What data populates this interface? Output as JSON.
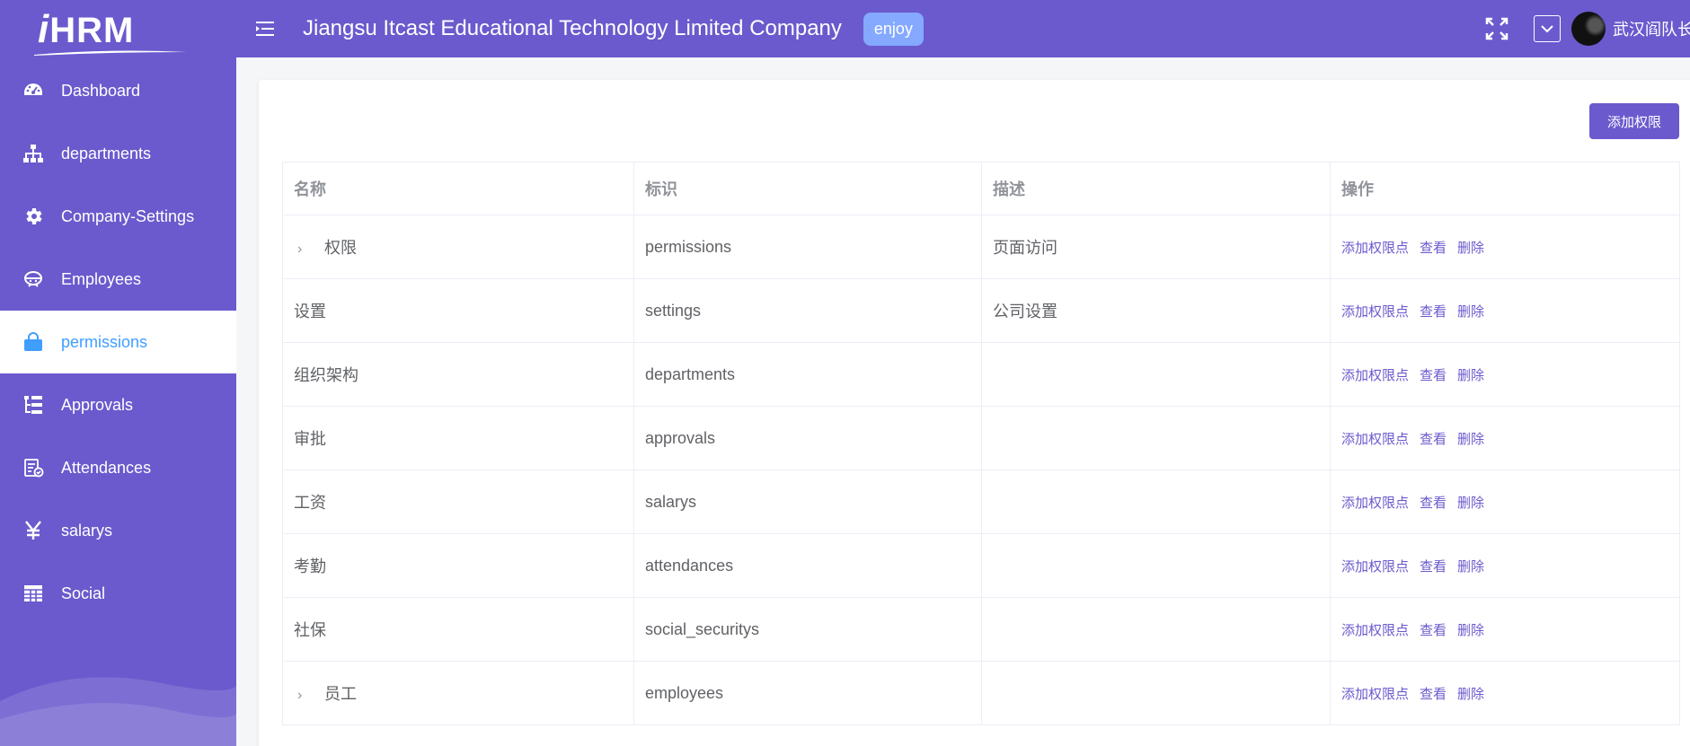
{
  "logo": {
    "text_i": "i",
    "text_rest": "HRM"
  },
  "sidebar": {
    "items": [
      {
        "label": "Dashboard",
        "icon": "dashboard-icon"
      },
      {
        "label": "departments",
        "icon": "org-tree-icon"
      },
      {
        "label": "Company-Settings",
        "icon": "gear-icon"
      },
      {
        "label": "Employees",
        "icon": "people-icon"
      },
      {
        "label": "permissions",
        "icon": "lock-icon",
        "active": true
      },
      {
        "label": "Approvals",
        "icon": "tree-table-icon"
      },
      {
        "label": "Attendances",
        "icon": "clipboard-icon"
      },
      {
        "label": "salarys",
        "icon": "yen-icon"
      },
      {
        "label": "Social",
        "icon": "table-icon"
      }
    ]
  },
  "header": {
    "company": "Jiangsu Itcast Educational Technology Limited Company",
    "badge": "enjoy",
    "username": "武汉阎队长"
  },
  "main": {
    "add_button": "添加权限",
    "columns": [
      "名称",
      "标识",
      "描述",
      "操作"
    ],
    "rows": [
      {
        "name": "权限",
        "code": "permissions",
        "desc": "页面访问",
        "expandable": true
      },
      {
        "name": "设置",
        "code": "settings",
        "desc": "公司设置",
        "expandable": false
      },
      {
        "name": "组织架构",
        "code": "departments",
        "desc": "",
        "expandable": false
      },
      {
        "name": "审批",
        "code": "approvals",
        "desc": "",
        "expandable": false
      },
      {
        "name": "工资",
        "code": "salarys",
        "desc": "",
        "expandable": false
      },
      {
        "name": "考勤",
        "code": "attendances",
        "desc": "",
        "expandable": false
      },
      {
        "name": "社保",
        "code": "social_securitys",
        "desc": "",
        "expandable": false
      },
      {
        "name": "员工",
        "code": "employees",
        "desc": "",
        "expandable": true
      }
    ],
    "actions": {
      "add": "添加权限点",
      "view": "查看",
      "delete": "删除"
    }
  },
  "colors": {
    "primary": "#6a5acd",
    "active_text": "#409eff",
    "badge": "#84a9ff"
  }
}
